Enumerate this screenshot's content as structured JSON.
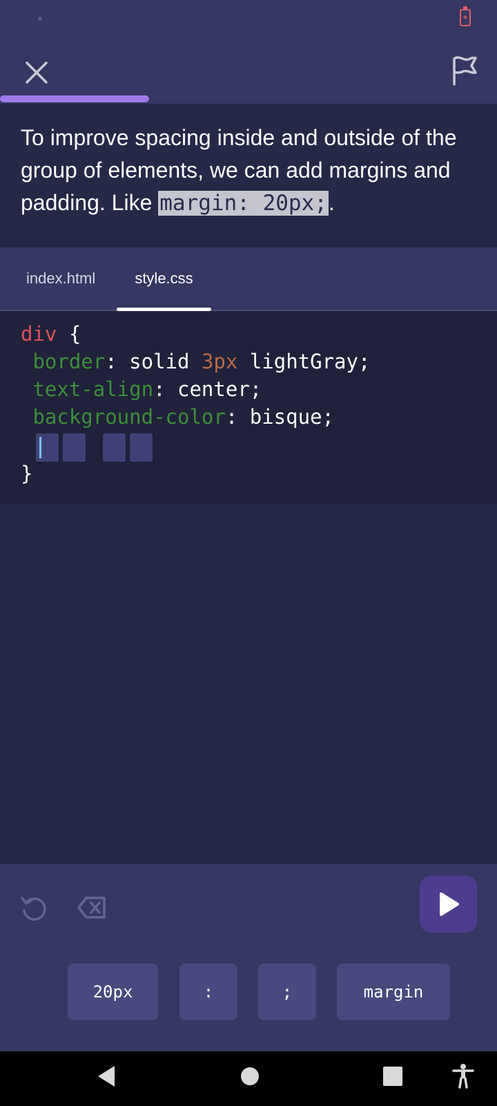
{
  "lesson": {
    "text_before": "To improve spacing inside and outside of the group of elements, we can add margins and padding. Like ",
    "code_example": "margin: 20px;",
    "text_after": "."
  },
  "tabs": [
    {
      "label": "index.html",
      "active": false
    },
    {
      "label": "style.css",
      "active": true
    }
  ],
  "code": {
    "selector": "div",
    "open_brace": "{",
    "close_brace": "}",
    "border_prop": "border",
    "border_value_a": "solid",
    "border_value_num": "3px",
    "border_value_b": "lightGray;",
    "align_prop": "text-align",
    "align_value": "center;",
    "bg_prop": "background-color",
    "bg_value": "bisque;",
    "colon": ":"
  },
  "answer_chips": [
    "20px",
    ":",
    ";",
    "margin"
  ],
  "progress_percent": 30,
  "icons": {
    "close": "close-icon",
    "flag": "flag-icon",
    "reset": "reset-icon",
    "erase": "erase-icon",
    "run": "play-icon",
    "nav_back": "back-icon",
    "nav_home": "home-icon",
    "nav_recent": "recent-apps-icon",
    "nav_accessibility": "accessibility-icon"
  },
  "colors": {
    "background": "#252847",
    "panel": "#363762",
    "editor": "#20213a",
    "progress": "#9f7bea",
    "run_button": "#4e3d8f",
    "chip": "#484a7d",
    "selector": "#e0505f",
    "property": "#3b8f3b",
    "number": "#b8694a"
  }
}
